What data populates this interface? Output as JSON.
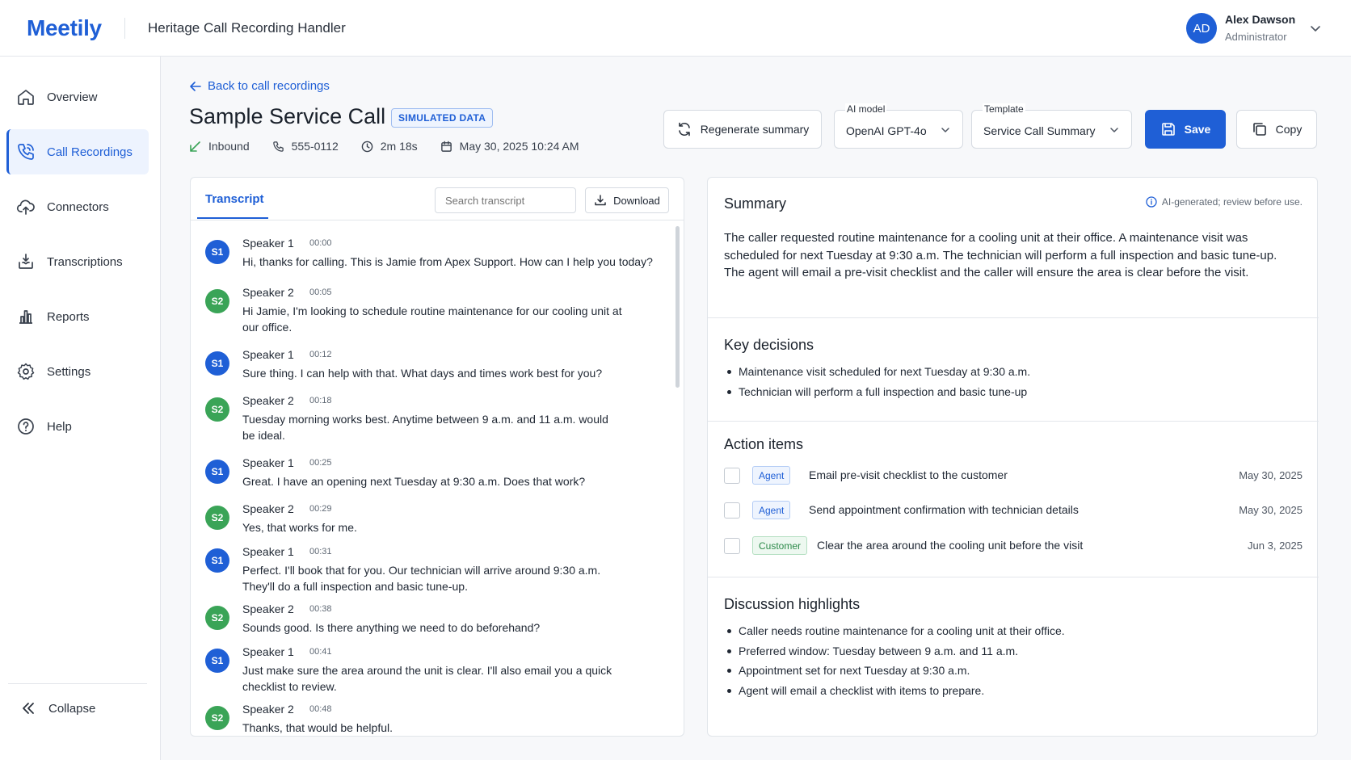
{
  "app": {
    "logo": "Meetily",
    "title": "Heritage Call Recording Handler"
  },
  "user": {
    "initials": "AD",
    "name": "Alex Dawson",
    "role": "Administrator"
  },
  "sidebar": {
    "items": [
      {
        "label": "Overview",
        "icon": "home-icon"
      },
      {
        "label": "Call Recordings",
        "icon": "phone-icon",
        "active": true
      },
      {
        "label": "Connectors",
        "icon": "cloud-upload-icon"
      },
      {
        "label": "Transcriptions",
        "icon": "download-tray-icon"
      },
      {
        "label": "Reports",
        "icon": "bar-chart-icon"
      },
      {
        "label": "Settings",
        "icon": "gear-icon"
      },
      {
        "label": "Help",
        "icon": "help-circle-icon"
      }
    ],
    "collapse_label": "Collapse"
  },
  "header": {
    "back_label": "Back to call recordings",
    "title": "Sample Service Call",
    "badge": "SIMULATED DATA",
    "direction": "Inbound",
    "phone": "555-0112",
    "duration": "2m 18s",
    "datetime": "May 30, 2025 10:24 AM"
  },
  "toolbar": {
    "regenerate_label": "Regenerate summary",
    "model_label": "AI model",
    "model_value": "OpenAI GPT-4o",
    "template_label": "Template",
    "template_value": "Service Call Summary",
    "save_label": "Save",
    "copy_label": "Copy"
  },
  "transcript": {
    "tab_label": "Transcript",
    "search_placeholder": "Search transcript",
    "download_label": "Download",
    "utterances": [
      {
        "badge": "S1",
        "speaker": "Speaker 1",
        "time": "00:00",
        "text": "Hi, thanks for calling. This is Jamie from Apex Support. How can I help you today?"
      },
      {
        "badge": "S2",
        "speaker": "Speaker 2",
        "time": "00:05",
        "text": "Hi Jamie, I'm looking to schedule routine maintenance for our cooling unit at our office."
      },
      {
        "badge": "S1",
        "speaker": "Speaker 1",
        "time": "00:12",
        "text": "Sure thing. I can help with that. What days and times work best for you?"
      },
      {
        "badge": "S2",
        "speaker": "Speaker 2",
        "time": "00:18",
        "text": "Tuesday morning works best. Anytime between 9 a.m. and 11 a.m. would be ideal."
      },
      {
        "badge": "S1",
        "speaker": "Speaker 1",
        "time": "00:25",
        "text": "Great. I have an opening next Tuesday at 9:30 a.m. Does that work?"
      },
      {
        "badge": "S2",
        "speaker": "Speaker 2",
        "time": "00:29",
        "text": "Yes, that works for me."
      },
      {
        "badge": "S1",
        "speaker": "Speaker 1",
        "time": "00:31",
        "text": "Perfect. I'll book that for you. Our technician will arrive around 9:30 a.m. They'll do a full inspection and basic tune-up."
      },
      {
        "badge": "S2",
        "speaker": "Speaker 2",
        "time": "00:38",
        "text": "Sounds good. Is there anything we need to do beforehand?"
      },
      {
        "badge": "S1",
        "speaker": "Speaker 1",
        "time": "00:41",
        "text": "Just make sure the area around the unit is clear. I'll also email you a quick checklist to review."
      },
      {
        "badge": "S2",
        "speaker": "Speaker 2",
        "time": "00:48",
        "text": "Thanks, that would be helpful."
      }
    ]
  },
  "summary": {
    "title": "Summary",
    "ai_note": "AI-generated; review before use.",
    "text": "The caller requested routine maintenance for a cooling unit at their office. A maintenance visit was scheduled for next Tuesday at 9:30 a.m. The technician will perform a full inspection and basic tune-up. The agent will email a pre-visit checklist and the caller will ensure the area is clear before the visit.",
    "key_decisions_title": "Key decisions",
    "key_decisions": [
      "Maintenance visit scheduled for next Tuesday at 9:30 a.m.",
      "Technician will perform a full inspection and basic tune-up"
    ],
    "action_items_title": "Action items",
    "action_items": [
      {
        "role": "Agent",
        "text": "Email pre-visit checklist to the customer",
        "date": "May 30, 2025"
      },
      {
        "role": "Agent",
        "text": "Send appointment confirmation with technician details",
        "date": "May 30, 2025"
      },
      {
        "role": "Customer",
        "text": "Clear the area around the cooling unit before the visit",
        "date": "Jun 3, 2025"
      }
    ],
    "highlights_title": "Discussion highlights",
    "highlights": [
      "Caller needs routine maintenance for a cooling unit at their office.",
      "Preferred window: Tuesday between 9 a.m. and 11 a.m.",
      "Appointment set for next Tuesday at 9:30 a.m.",
      "Agent will email a checklist with items to prepare."
    ]
  },
  "colors": {
    "accent": "#1f5fd6",
    "speaker1": "#1f5fd6",
    "speaker2": "#3aa457"
  }
}
